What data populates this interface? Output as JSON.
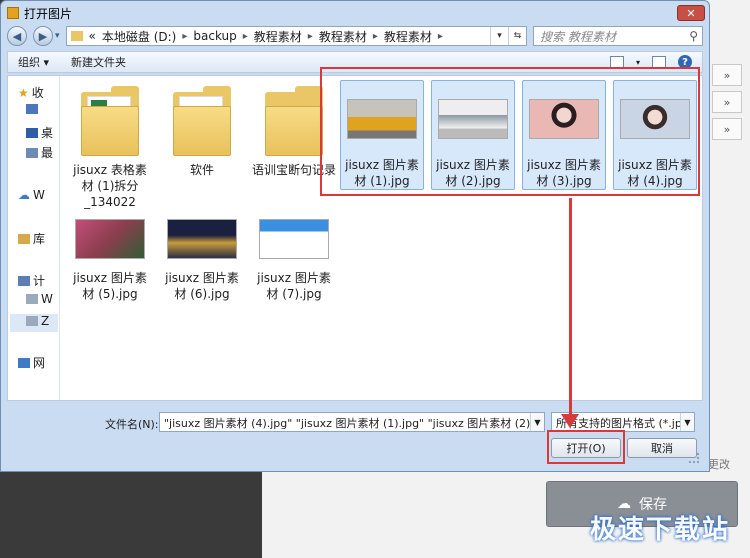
{
  "window": {
    "title": "打开图片",
    "close": "✕"
  },
  "address": {
    "prefix": "«",
    "segments": [
      "本地磁盘 (D:)",
      "backup",
      "教程素材",
      "教程素材",
      "教程素材"
    ],
    "search_placeholder": "搜索 教程素材"
  },
  "toolbar": {
    "organize": "组织 ▾",
    "new_folder": "新建文件夹"
  },
  "sidebar": {
    "items": [
      {
        "label": "收",
        "icon": "star-icon"
      },
      {
        "label": "",
        "icon": "download-icon"
      },
      {
        "label": "桌",
        "icon": "desktop-icon"
      },
      {
        "label": "最",
        "icon": "recent-icon"
      },
      {
        "label": "W",
        "icon": "cloud-icon"
      },
      {
        "label": "库",
        "icon": "library-icon"
      },
      {
        "label": "计",
        "icon": "computer-icon"
      },
      {
        "label": "W",
        "icon": "drive-icon"
      },
      {
        "label": "Z",
        "icon": "drive-icon"
      },
      {
        "label": "网",
        "icon": "network-icon"
      }
    ]
  },
  "files": [
    {
      "name": "jisuxz 表格素材 (1)拆分_134022",
      "kind": "folder-excel"
    },
    {
      "name": "软件",
      "kind": "folder"
    },
    {
      "name": "语训宝断句记录",
      "kind": "folder"
    },
    {
      "name": "jisuxz 图片素材 (1).jpg",
      "kind": "photo",
      "color": "#e0a21f",
      "selected": true
    },
    {
      "name": "jisuxz 图片素材 (2).jpg",
      "kind": "photo",
      "color": "#8d9aa3",
      "selected": true
    },
    {
      "name": "jisuxz 图片素材 (3).jpg",
      "kind": "photo",
      "color": "#e9b8b5",
      "selected": true
    },
    {
      "name": "jisuxz 图片素材 (4).jpg",
      "kind": "photo",
      "color": "#c9d4e4",
      "selected": true
    },
    {
      "name": "jisuxz 图片素材 (5).jpg",
      "kind": "photo",
      "color": "#8b3e4f"
    },
    {
      "name": "jisuxz 图片素材 (6).jpg",
      "kind": "photo",
      "color": "#2a2f45"
    },
    {
      "name": "jisuxz 图片素材 (7).jpg",
      "kind": "photo",
      "color": "#3b8fe0"
    }
  ],
  "bottom": {
    "filename_label": "文件名(N):",
    "filename_value": "\"jisuxz 图片素材 (4).jpg\" \"jisuxz 图片素材 (1).jpg\" \"jisuxz 图片素材 (2).jpg\" \"jisuxz 图片素",
    "filetype_value": "所有支持的图片格式 (*.jpg;*.jp",
    "open_button": "打开(O)",
    "cancel_button": "取消"
  },
  "background": {
    "row_glyph": "»",
    "change_text": "更改",
    "save_button": "保存",
    "watermark": "极速下载站"
  },
  "colors": {
    "accent_red": "#d9393a",
    "selection": "#d8e8fb"
  }
}
